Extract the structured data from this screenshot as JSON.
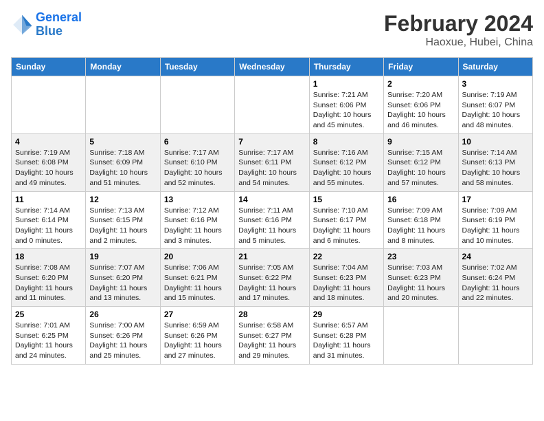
{
  "logo": {
    "line1": "General",
    "line2": "Blue"
  },
  "title": "February 2024",
  "subtitle": "Haoxue, Hubei, China",
  "weekdays": [
    "Sunday",
    "Monday",
    "Tuesday",
    "Wednesday",
    "Thursday",
    "Friday",
    "Saturday"
  ],
  "weeks": [
    [
      {
        "day": "",
        "info": ""
      },
      {
        "day": "",
        "info": ""
      },
      {
        "day": "",
        "info": ""
      },
      {
        "day": "",
        "info": ""
      },
      {
        "day": "1",
        "info": "Sunrise: 7:21 AM\nSunset: 6:06 PM\nDaylight: 10 hours\nand 45 minutes."
      },
      {
        "day": "2",
        "info": "Sunrise: 7:20 AM\nSunset: 6:06 PM\nDaylight: 10 hours\nand 46 minutes."
      },
      {
        "day": "3",
        "info": "Sunrise: 7:19 AM\nSunset: 6:07 PM\nDaylight: 10 hours\nand 48 minutes."
      }
    ],
    [
      {
        "day": "4",
        "info": "Sunrise: 7:19 AM\nSunset: 6:08 PM\nDaylight: 10 hours\nand 49 minutes."
      },
      {
        "day": "5",
        "info": "Sunrise: 7:18 AM\nSunset: 6:09 PM\nDaylight: 10 hours\nand 51 minutes."
      },
      {
        "day": "6",
        "info": "Sunrise: 7:17 AM\nSunset: 6:10 PM\nDaylight: 10 hours\nand 52 minutes."
      },
      {
        "day": "7",
        "info": "Sunrise: 7:17 AM\nSunset: 6:11 PM\nDaylight: 10 hours\nand 54 minutes."
      },
      {
        "day": "8",
        "info": "Sunrise: 7:16 AM\nSunset: 6:12 PM\nDaylight: 10 hours\nand 55 minutes."
      },
      {
        "day": "9",
        "info": "Sunrise: 7:15 AM\nSunset: 6:12 PM\nDaylight: 10 hours\nand 57 minutes."
      },
      {
        "day": "10",
        "info": "Sunrise: 7:14 AM\nSunset: 6:13 PM\nDaylight: 10 hours\nand 58 minutes."
      }
    ],
    [
      {
        "day": "11",
        "info": "Sunrise: 7:14 AM\nSunset: 6:14 PM\nDaylight: 11 hours\nand 0 minutes."
      },
      {
        "day": "12",
        "info": "Sunrise: 7:13 AM\nSunset: 6:15 PM\nDaylight: 11 hours\nand 2 minutes."
      },
      {
        "day": "13",
        "info": "Sunrise: 7:12 AM\nSunset: 6:16 PM\nDaylight: 11 hours\nand 3 minutes."
      },
      {
        "day": "14",
        "info": "Sunrise: 7:11 AM\nSunset: 6:16 PM\nDaylight: 11 hours\nand 5 minutes."
      },
      {
        "day": "15",
        "info": "Sunrise: 7:10 AM\nSunset: 6:17 PM\nDaylight: 11 hours\nand 6 minutes."
      },
      {
        "day": "16",
        "info": "Sunrise: 7:09 AM\nSunset: 6:18 PM\nDaylight: 11 hours\nand 8 minutes."
      },
      {
        "day": "17",
        "info": "Sunrise: 7:09 AM\nSunset: 6:19 PM\nDaylight: 11 hours\nand 10 minutes."
      }
    ],
    [
      {
        "day": "18",
        "info": "Sunrise: 7:08 AM\nSunset: 6:20 PM\nDaylight: 11 hours\nand 11 minutes."
      },
      {
        "day": "19",
        "info": "Sunrise: 7:07 AM\nSunset: 6:20 PM\nDaylight: 11 hours\nand 13 minutes."
      },
      {
        "day": "20",
        "info": "Sunrise: 7:06 AM\nSunset: 6:21 PM\nDaylight: 11 hours\nand 15 minutes."
      },
      {
        "day": "21",
        "info": "Sunrise: 7:05 AM\nSunset: 6:22 PM\nDaylight: 11 hours\nand 17 minutes."
      },
      {
        "day": "22",
        "info": "Sunrise: 7:04 AM\nSunset: 6:23 PM\nDaylight: 11 hours\nand 18 minutes."
      },
      {
        "day": "23",
        "info": "Sunrise: 7:03 AM\nSunset: 6:23 PM\nDaylight: 11 hours\nand 20 minutes."
      },
      {
        "day": "24",
        "info": "Sunrise: 7:02 AM\nSunset: 6:24 PM\nDaylight: 11 hours\nand 22 minutes."
      }
    ],
    [
      {
        "day": "25",
        "info": "Sunrise: 7:01 AM\nSunset: 6:25 PM\nDaylight: 11 hours\nand 24 minutes."
      },
      {
        "day": "26",
        "info": "Sunrise: 7:00 AM\nSunset: 6:26 PM\nDaylight: 11 hours\nand 25 minutes."
      },
      {
        "day": "27",
        "info": "Sunrise: 6:59 AM\nSunset: 6:26 PM\nDaylight: 11 hours\nand 27 minutes."
      },
      {
        "day": "28",
        "info": "Sunrise: 6:58 AM\nSunset: 6:27 PM\nDaylight: 11 hours\nand 29 minutes."
      },
      {
        "day": "29",
        "info": "Sunrise: 6:57 AM\nSunset: 6:28 PM\nDaylight: 11 hours\nand 31 minutes."
      },
      {
        "day": "",
        "info": ""
      },
      {
        "day": "",
        "info": ""
      }
    ]
  ]
}
